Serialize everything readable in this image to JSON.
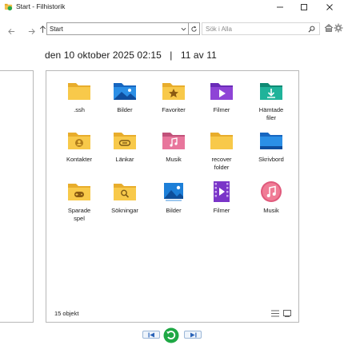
{
  "window": {
    "title": "Start - Filhistorik"
  },
  "toolbar": {
    "address": "Start",
    "search_placeholder": "Sök i Alla"
  },
  "header": {
    "date": "den 10 oktober 2025 02:15",
    "separator": "|",
    "position": "11 av 11"
  },
  "items": [
    {
      "label": "",
      "label_lines": [
        ".ssh"
      ],
      "icon": "folder-icon"
    },
    {
      "label_lines": [
        "Bilder"
      ],
      "icon": "pictures-folder-icon"
    },
    {
      "label_lines": [
        "Favoriter"
      ],
      "icon": "favorites-folder-icon"
    },
    {
      "label_lines": [
        "Filmer"
      ],
      "icon": "videos-folder-icon"
    },
    {
      "label_lines": [
        "Hämtade",
        "filer"
      ],
      "icon": "downloads-folder-icon"
    },
    {
      "label_lines": [
        "Kontakter"
      ],
      "icon": "contacts-folder-icon"
    },
    {
      "label_lines": [
        "Länkar"
      ],
      "icon": "links-folder-icon"
    },
    {
      "label_lines": [
        "Musik"
      ],
      "icon": "music-folder-icon"
    },
    {
      "label_lines": [
        "recover",
        "folder"
      ],
      "icon": "folder-icon"
    },
    {
      "label_lines": [
        "Skrivbord"
      ],
      "icon": "desktop-folder-icon"
    },
    {
      "label_lines": [
        "Sparade",
        "spel"
      ],
      "icon": "saved-games-folder-icon"
    },
    {
      "label_lines": [
        "Sökningar"
      ],
      "icon": "searches-folder-icon"
    },
    {
      "label_lines": [
        "Bilder"
      ],
      "icon": "pictures-library-icon"
    },
    {
      "label_lines": [
        "Filmer"
      ],
      "icon": "videos-library-icon"
    },
    {
      "label_lines": [
        "Musik"
      ],
      "icon": "music-library-icon"
    }
  ],
  "status": {
    "count": "15 objekt"
  },
  "colors": {
    "folder_yellow": "#f8c94a",
    "folder_tab": "#e8ad2c",
    "accent_blue": "#1b78d0",
    "restore_green": "#1fa845"
  }
}
